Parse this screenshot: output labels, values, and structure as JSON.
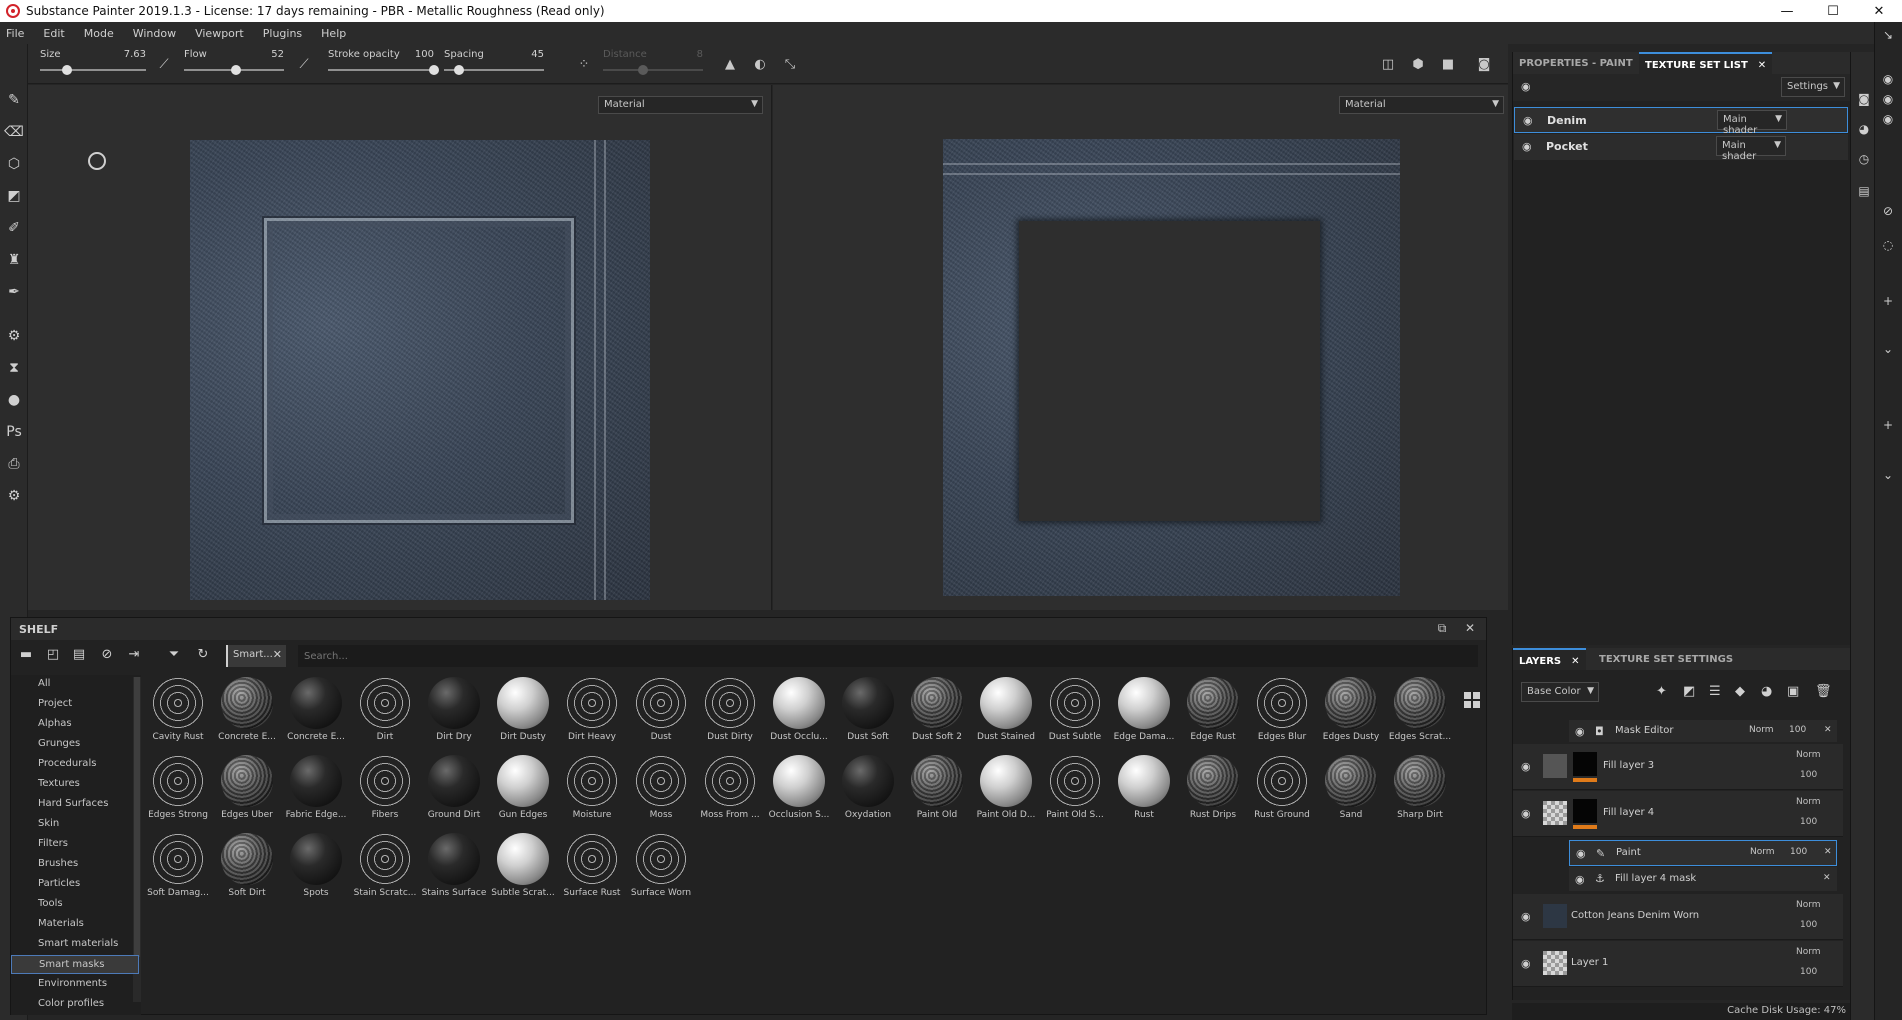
{
  "window": {
    "title": "Substance Painter 2019.1.3 - License: 17 days remaining - PBR - Metallic Roughness (Read only)",
    "controls": [
      "—",
      "☐",
      "✕"
    ]
  },
  "menu": [
    "File",
    "Edit",
    "Mode",
    "Window",
    "Viewport",
    "Plugins",
    "Help"
  ],
  "toolbar": {
    "size_label": "Size",
    "size_value": "7.63",
    "size_level": 0.25,
    "flow_label": "Flow",
    "flow_value": "52",
    "flow_level": 0.52,
    "stroke_label": "Stroke opacity",
    "stroke_value": "100",
    "stroke_level": 1.0,
    "spacing_label": "Spacing",
    "spacing_value": "45",
    "spacing_level": 0.15,
    "distance_label": "Distance",
    "distance_value": "8",
    "distance_level": 0.4
  },
  "viewport3d": {
    "material_mode": "Material"
  },
  "viewport2d": {
    "material_mode": "Material"
  },
  "shelf": {
    "title": "SHELF",
    "filter_chip": "Smart...",
    "search_placeholder": "Search...",
    "categories": [
      "All",
      "Project",
      "Alphas",
      "Grunges",
      "Procedurals",
      "Textures",
      "Hard Surfaces",
      "Skin",
      "Filters",
      "Brushes",
      "Particles",
      "Tools",
      "Materials",
      "Smart materials",
      "Smart masks",
      "Environments",
      "Color profiles"
    ],
    "selected_category": "Smart masks",
    "assets": [
      "Cavity Rust",
      "Concrete E...",
      "Concrete E...",
      "Dirt",
      "Dirt Dry",
      "Dirt Dusty",
      "Dirt Heavy",
      "Dust",
      "Dust Dirty",
      "Dust Occlu...",
      "Dust Soft",
      "Dust Soft 2",
      "Dust Stained",
      "Dust Subtle",
      "Edge Dama...",
      "Edge Rust",
      "Edges Blur",
      "Edges Dusty",
      "Edges Scrat...",
      "Edges Strong",
      "Edges Uber",
      "Fabric Edge...",
      "Fibers",
      "Ground Dirt",
      "Gun Edges",
      "Moisture",
      "Moss",
      "Moss From ...",
      "Occlusion S...",
      "Oxydation",
      "Paint Old",
      "Paint Old D...",
      "Paint Old S...",
      "Rust",
      "Rust Drips",
      "Rust Ground",
      "Sand",
      "Sharp Dirt",
      "Soft Damag...",
      "Soft Dirt",
      "Spots",
      "Stain Scratc...",
      "Stains Surface",
      "Subtle Scrat...",
      "Surface Rust",
      "Surface Worn"
    ]
  },
  "properties": {
    "tab1": "PROPERTIES - PAINT",
    "tab2": "TEXTURE SET LIST",
    "settings_label": "Settings",
    "texture_sets": [
      {
        "name": "Denim",
        "shader": "Main shader"
      },
      {
        "name": "Pocket",
        "shader": "Main shader"
      }
    ]
  },
  "layers": {
    "tab1": "LAYERS",
    "tab2": "TEXTURE SET SETTINGS",
    "channel": "Base Color",
    "mask_editor": {
      "name": "Mask Editor",
      "blend": "Norm",
      "opacity": "100"
    },
    "fill3": {
      "name": "Fill layer 3",
      "blend": "Norm",
      "opacity": "100"
    },
    "fill4": {
      "name": "Fill layer 4",
      "blend": "Norm",
      "opacity": "100"
    },
    "paint": {
      "name": "Paint",
      "blend": "Norm",
      "opacity": "100"
    },
    "fill4mask": {
      "name": "Fill layer 4 mask"
    },
    "cotton": {
      "name": "Cotton Jeans Denim Worn",
      "blend": "Norm",
      "opacity": "100"
    },
    "layer1": {
      "name": "Layer 1",
      "blend": "Norm",
      "opacity": "100"
    }
  },
  "status": {
    "cache": "Cache Disk Usage:",
    "cache_value": "47%"
  },
  "colors": {
    "accent": "#3d8edb",
    "fill_mask_bar": "#e07b1a",
    "brand": "#d2232a"
  }
}
